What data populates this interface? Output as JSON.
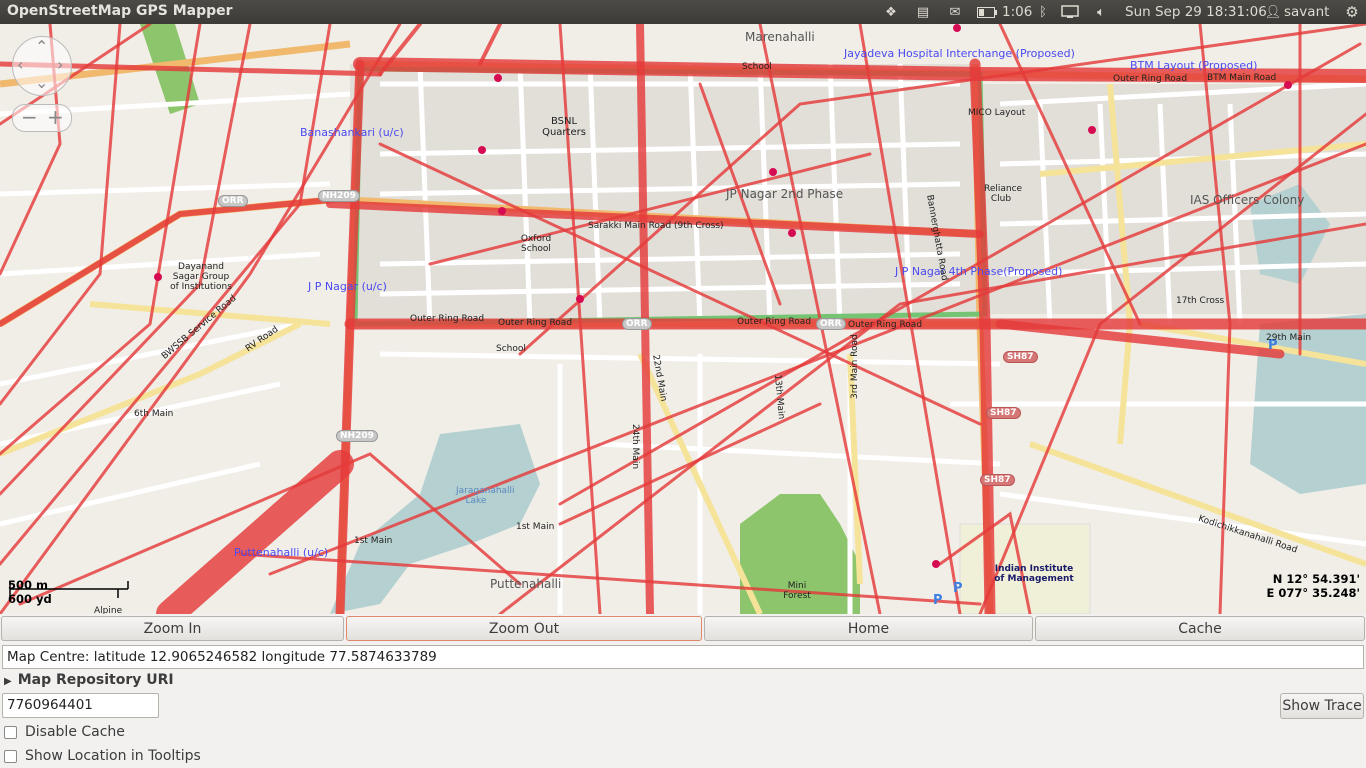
{
  "topbar": {
    "title": "OpenStreetMap GPS Mapper",
    "battery_time": "1:06",
    "clock": "Sun Sep 29 18:31:06",
    "user": "savant"
  },
  "map": {
    "labels": {
      "marenahalli": "Marenahalli",
      "jayadeva": "Jayadeva Hospital Interchange (Proposed)",
      "btm_layout": "BTM Layout (Proposed)",
      "outer_ring_road": "Outer Ring Road",
      "btm_main_road": "BTM Main Road",
      "banashankari": "Banashankari (u/c)",
      "bsnl": "BSNL Quarters",
      "jp_nagar_2nd": "JP Nagar 2nd Phase",
      "sarakki": "Sarakki Main Road (9th Cross)",
      "jp_nagar_uc": "J P Nagar (u/c)",
      "jp_nagar_4th": "J P Nagar 4th Phase(Proposed)",
      "dayanand": "Dayanand Sagar Group of Institutions",
      "oxford": "Oxford School",
      "ias_colony": "IAS Officers Colony",
      "reliance_club": "Reliance Club",
      "bannerghatta": "Bannerghatta Road",
      "nh209": "NH209",
      "sh87": "SH87",
      "orr": "ORR",
      "jaraganahalli": "Jaraganahalli Lake",
      "puttenahalli_uc": "Puttenahalli (u/c)",
      "puttenahalli": "Puttenahalli",
      "mini_forest": "Mini Forest",
      "iim": "Indian Institute of Management",
      "koramangala_road": "Kodichikkanahalli Road",
      "29th_main": "29th Main",
      "17th_cross": "17th Cross",
      "13th_main": "13th Main",
      "22nd_main": "22nd Main",
      "24th_main": "24th Main",
      "3rd_main_road": "3rd Main Road",
      "bwssb": "BWSSB Service Road",
      "rv_road": "RV Road",
      "6th_main": "6th Main",
      "1st_main": "1st Main",
      "school": "School",
      "alpine": "Alpine",
      "micolayout": "MICO Layout"
    },
    "scale_m": "500 m",
    "scale_yd": "600 yd",
    "lat": "N 12° 54.391'",
    "lon": "E 077° 35.248'"
  },
  "buttons": {
    "zoom_in": "Zoom In",
    "zoom_out": "Zoom Out",
    "home": "Home",
    "cache": "Cache",
    "show_trace": "Show Trace"
  },
  "status": "Map Centre: latitude 12.9065246582 longitude 77.5874633789",
  "repo_label": "Map Repository URI",
  "repo_value": "7760964401",
  "options": {
    "disable_cache": "Disable Cache",
    "show_location": "Show Location in Tooltips"
  }
}
